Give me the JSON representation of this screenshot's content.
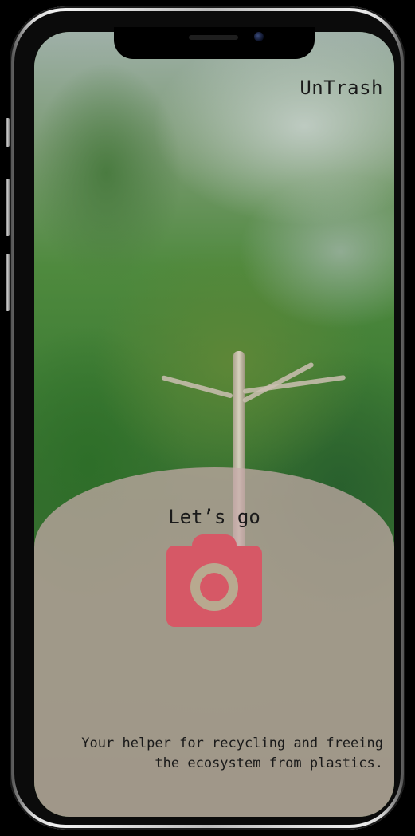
{
  "app": {
    "title": "UnTrash"
  },
  "hero": {
    "cta_label": "Let’s go",
    "camera_icon": "camera-icon",
    "tagline": "Your helper for recycling and freeing the ecosystem from plastics."
  },
  "colors": {
    "accent": "#d65866",
    "overlay": "#c8aaaa",
    "lens": "#b8a98f"
  }
}
